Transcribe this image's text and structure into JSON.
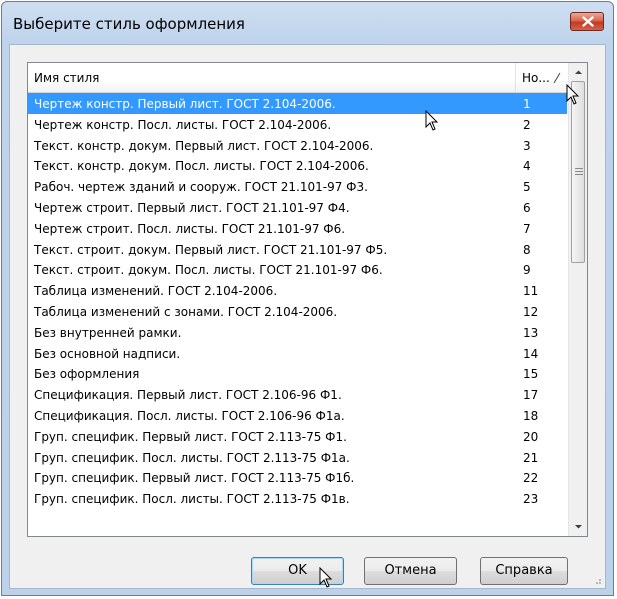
{
  "window": {
    "title": "Выберите стиль оформления"
  },
  "listview": {
    "columns": {
      "name": "Имя стиля",
      "number": "Но..."
    },
    "selected_index": 0,
    "rows": [
      {
        "name": "Чертеж констр. Первый лист. ГОСТ 2.104-2006.",
        "number": "1"
      },
      {
        "name": "Чертеж констр. Посл. листы. ГОСТ 2.104-2006.",
        "number": "2"
      },
      {
        "name": "Текст. констр. докум. Первый лист. ГОСТ 2.104-2006.",
        "number": "3"
      },
      {
        "name": "Текст. констр. докум. Посл. листы. ГОСТ 2.104-2006.",
        "number": "4"
      },
      {
        "name": "Рабоч. чертеж зданий и сооруж. ГОСТ 21.101-97 Ф3.",
        "number": "5"
      },
      {
        "name": "Чертеж строит. Первый лист. ГОСТ 21.101-97 Ф4.",
        "number": "6"
      },
      {
        "name": "Чертеж строит. Посл. листы.  ГОСТ 21.101-97 Ф6.",
        "number": "7"
      },
      {
        "name": "Текст. строит. докум. Первый лист. ГОСТ 21.101-97 Ф5.",
        "number": "8"
      },
      {
        "name": "Текст. строит. докум. Посл. листы. ГОСТ 21.101-97 Ф6.",
        "number": "9"
      },
      {
        "name": "Таблица изменений. ГОСТ 2.104-2006.",
        "number": "11"
      },
      {
        "name": "Таблица изменений с зонами. ГОСТ 2.104-2006.",
        "number": "12"
      },
      {
        "name": "Без внутренней рамки.",
        "number": "13"
      },
      {
        "name": "Без основной надписи.",
        "number": "14"
      },
      {
        "name": "Без оформления",
        "number": "15"
      },
      {
        "name": "Спецификация. Первый лист. ГОСТ 2.106-96 Ф1.",
        "number": "17"
      },
      {
        "name": "Спецификация. Посл. листы. ГОСТ 2.106-96 Ф1а.",
        "number": "18"
      },
      {
        "name": "Груп. специфик. Первый лист. ГОСТ 2.113-75 Ф1.",
        "number": "20"
      },
      {
        "name": "Груп. специфик. Посл. листы. ГОСТ 2.113-75 Ф1а.",
        "number": "21"
      },
      {
        "name": "Груп. специфик. Первый лист. ГОСТ 2.113-75 Ф1б.",
        "number": "22"
      },
      {
        "name": "Груп. специфик. Посл. листы. ГОСТ 2.113-75 Ф1в.",
        "number": "23"
      }
    ]
  },
  "buttons": {
    "ok": "OK",
    "cancel": "Отмена",
    "help": "Справка"
  },
  "colors": {
    "selection": "#3399ff",
    "close_button": "#c33a1f"
  },
  "icons": {
    "close": "close-icon",
    "scroll_up": "chevron-up-icon",
    "scroll_down": "chevron-down-icon",
    "cursor": "mouse-pointer-icon"
  }
}
